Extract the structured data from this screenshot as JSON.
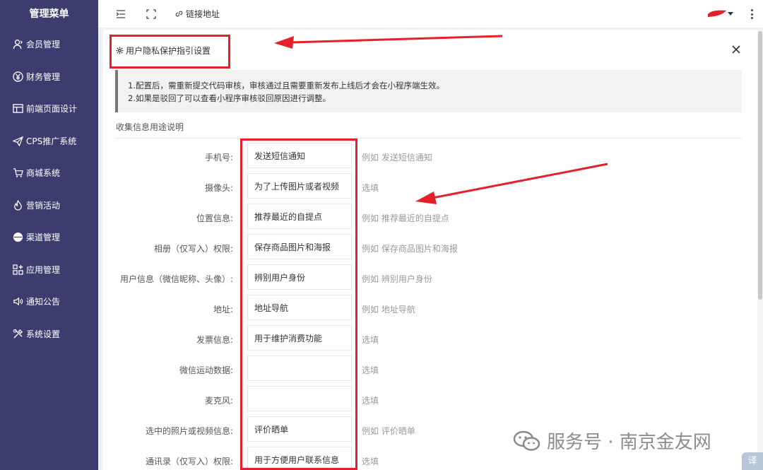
{
  "sidebar": {
    "title": "管理菜单",
    "items": [
      {
        "label": "会员管理",
        "icon": "user-icon"
      },
      {
        "label": "财务管理",
        "icon": "yen-icon"
      },
      {
        "label": "前端页面设计",
        "icon": "layout-icon"
      },
      {
        "label": "CPS推广系统",
        "icon": "send-icon"
      },
      {
        "label": "商城系统",
        "icon": "cart-icon"
      },
      {
        "label": "营销活动",
        "icon": "fire-icon"
      },
      {
        "label": "渠道管理",
        "icon": "disc-icon"
      },
      {
        "label": "应用管理",
        "icon": "apps-icon"
      },
      {
        "label": "通知公告",
        "icon": "speaker-icon"
      },
      {
        "label": "系统设置",
        "icon": "tools-icon"
      }
    ]
  },
  "topbar": {
    "link_label": "链接地址"
  },
  "panel": {
    "title": "用户隐私保护指引设置",
    "notice_line1": "1.配置后，需重新提交代码审核，审核通过且需要重新发布上线后才会在小程序端生效。",
    "notice_line2": "2.如果是驳回了可以查看小程序审核驳回原因进行调整。",
    "section_label": "收集信息用途说明",
    "rows": [
      {
        "label": "手机号:",
        "value": "发送短信通知",
        "hint": "例如 发送短信通知"
      },
      {
        "label": "摄像头:",
        "value": "为了上传图片或者视频",
        "hint": "选填"
      },
      {
        "label": "位置信息:",
        "value": "推荐最近的自提点",
        "hint": "例如 推荐最近的自提点"
      },
      {
        "label": "相册（仅写入）权限:",
        "value": "保存商品图片和海报",
        "hint": "例如 保存商品图片和海报"
      },
      {
        "label": "用户信息（微信昵称、头像）:",
        "value": "辨别用户身份",
        "hint": "例如 辨别用户身份"
      },
      {
        "label": "地址:",
        "value": "地址导航",
        "hint": "例如 地址导航"
      },
      {
        "label": "发票信息:",
        "value": "用于维护消费功能",
        "hint": "选填"
      },
      {
        "label": "微信运动数据:",
        "value": "",
        "hint": "选填"
      },
      {
        "label": "麦克风:",
        "value": "",
        "hint": "选填"
      },
      {
        "label": "选中的照片或视频信息:",
        "value": "评价晒单",
        "hint": "例如 评价晒单"
      },
      {
        "label": "通讯录（仅写入）权限:",
        "value": "用于方便用户联系信息",
        "hint": "选填"
      }
    ]
  },
  "watermark": "服务号 · 南京金友网",
  "corner_badge": "译",
  "colors": {
    "sidebar_bg": "#3d3c6e",
    "annotation_red": "#e5202b",
    "notice_bar": "#777777"
  }
}
